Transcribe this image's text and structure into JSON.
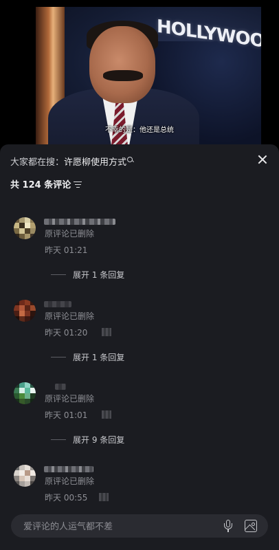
{
  "video": {
    "sign_text": "HOLLYWOOD",
    "subtitle": "不幸的是：他还是总统"
  },
  "sheet": {
    "search_prefix": "大家都在搜：",
    "search_term": "许愿柳使用方式",
    "comment_count_text": "共 124 条评论"
  },
  "comments": [
    {
      "text": "原评论已删除",
      "time": "昨天 01:21",
      "expand": "展开 1 条回复"
    },
    {
      "text": "原评论已删除",
      "time": "昨天 01:20",
      "expand": "展开 1 条回复"
    },
    {
      "text": "原评论已删除",
      "time": "昨天 01:01",
      "expand": "展开 9 条回复"
    },
    {
      "text": "原评论已删除",
      "time": "昨天 00:55"
    }
  ],
  "input": {
    "placeholder": "爱评论的人运气都不差"
  },
  "colors": {
    "sheet_bg": "#1b1c21",
    "input_bg": "#2a2b31",
    "muted_text": "#8e8f95"
  },
  "icons": [
    "search-icon",
    "close-icon",
    "sort-icon",
    "mic-icon",
    "image-icon"
  ]
}
